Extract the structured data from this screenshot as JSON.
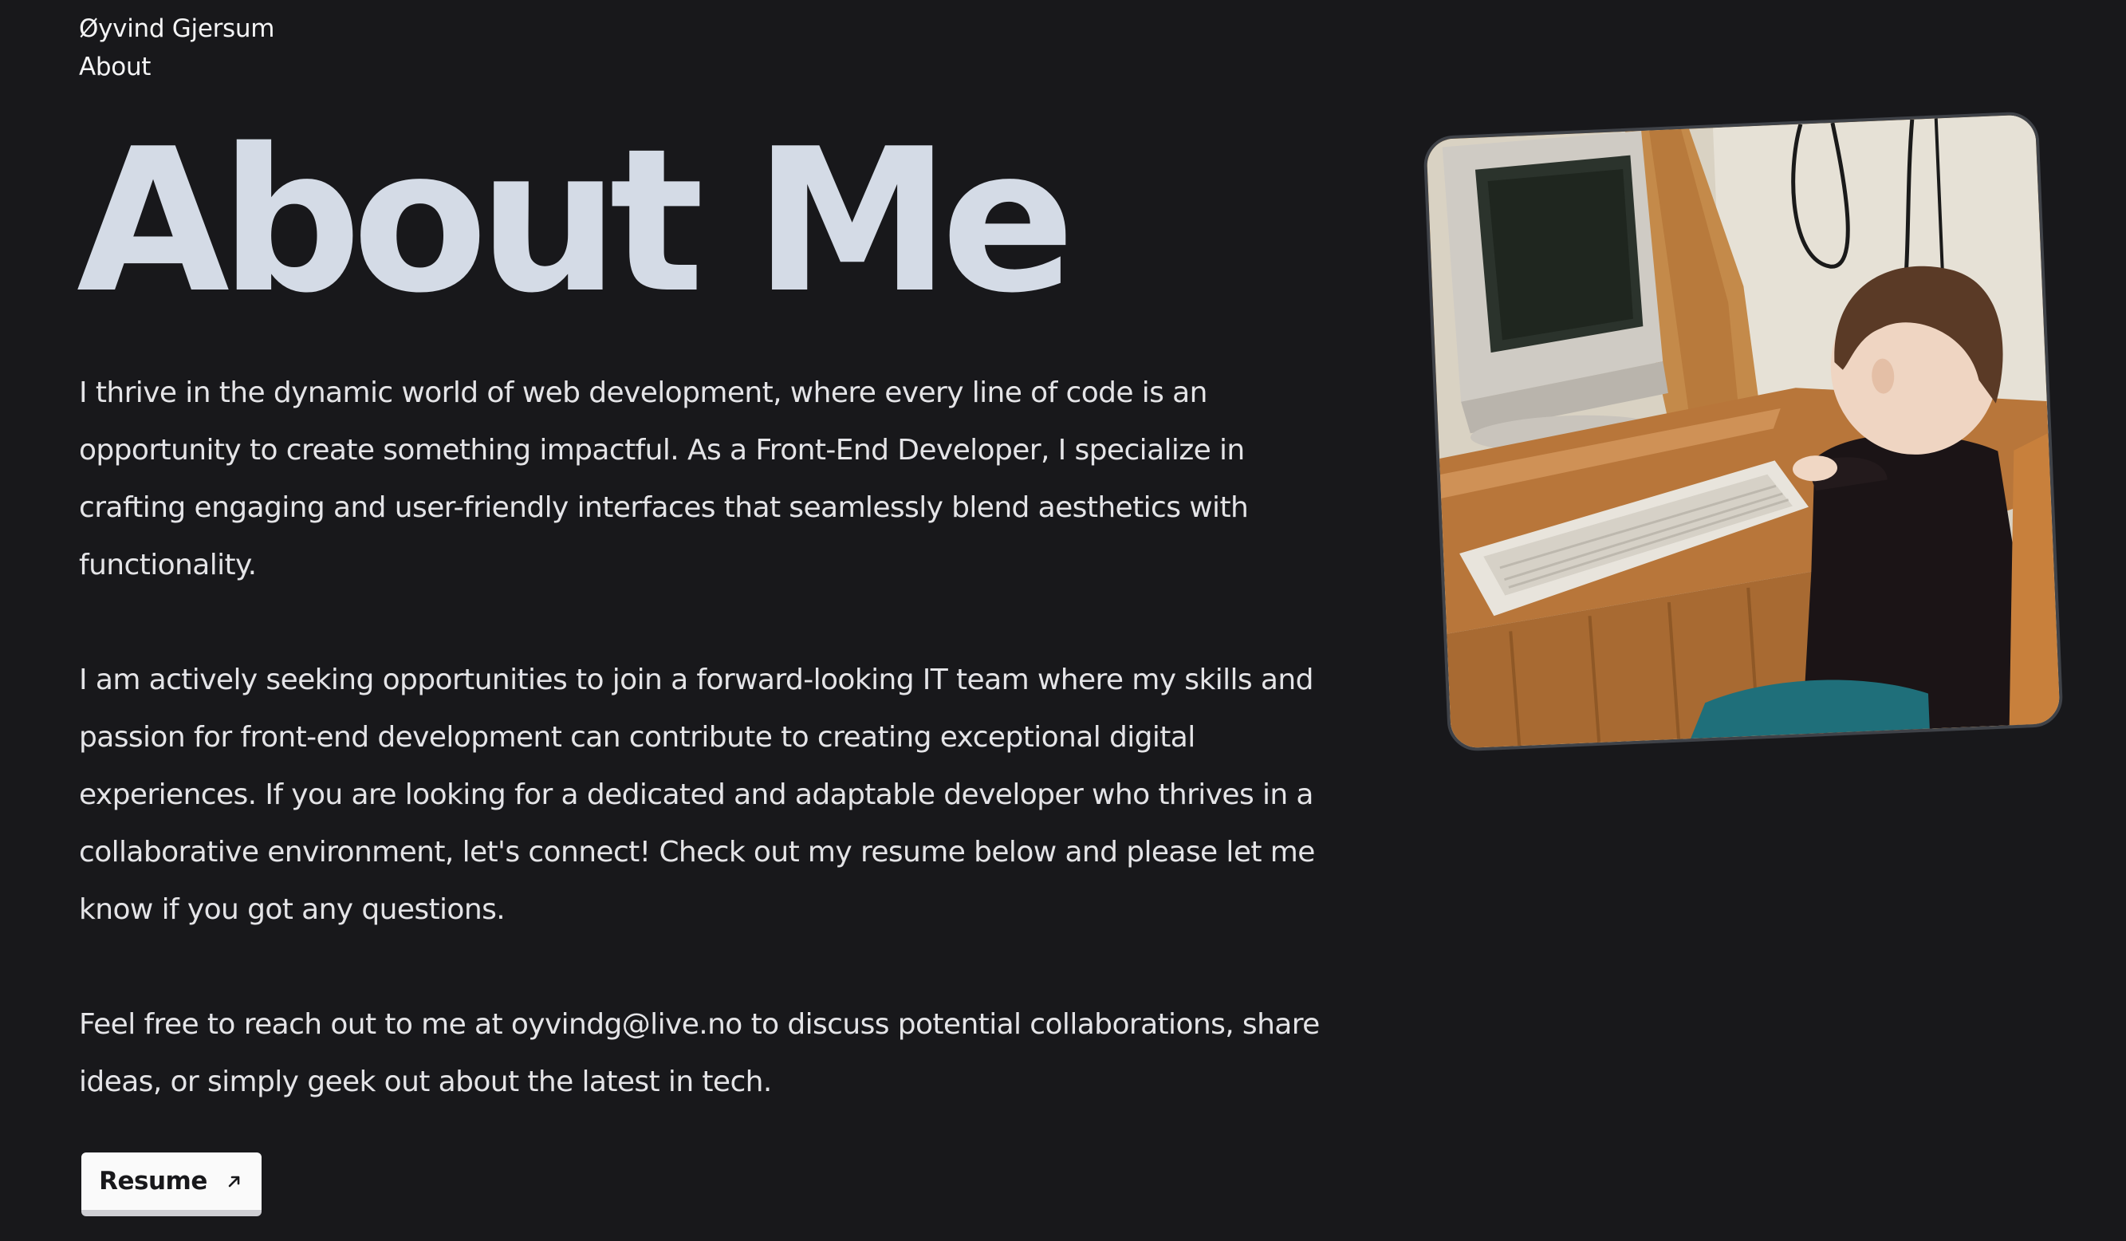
{
  "nav": {
    "home_link": "Øyvind Gjersum",
    "current_page": "About"
  },
  "page": {
    "title": "About Me"
  },
  "content": {
    "paragraphs": [
      "I thrive in the dynamic world of web development, where every line of code is an opportunity to create something impactful. As a Front-End Developer, I specialize in crafting engaging and user-friendly interfaces that seamlessly blend aesthetics with functionality.",
      "I am actively seeking opportunities to join a forward-looking IT team where my skills and passion for front-end development can contribute to creating exceptional digital experiences. If you are looking for a dedicated and adaptable developer who thrives in a collaborative environment, let's connect! Check out my resume below and please let me know if you got any questions.",
      "Feel free to reach out to me at oyvindg@live.no to discuss potential collaborations, share ideas, or simply geek out about the latest in tech."
    ]
  },
  "resume_button": {
    "label": "Resume",
    "icon": "arrow-up-right-icon"
  },
  "photo": {
    "alt": "Child sitting at a wooden desk looking at an old CRT computer monitor"
  },
  "colors": {
    "background": "#18181b",
    "title": "#d4dbe6",
    "text": "#e4e4e7",
    "button_bg": "#fafafa",
    "button_text": "#18181b"
  }
}
